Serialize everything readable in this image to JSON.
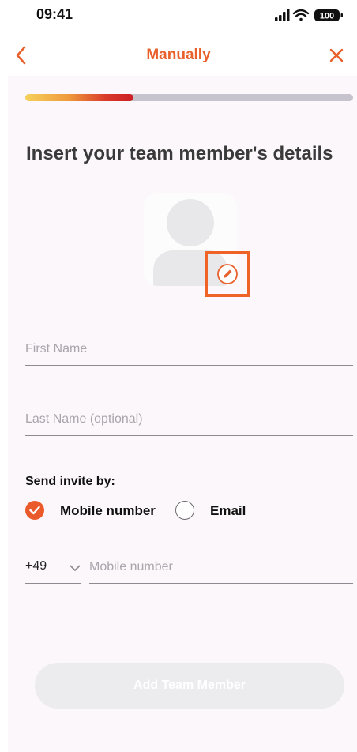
{
  "status_bar": {
    "time": "09:41",
    "battery": "100",
    "icons": [
      "signal-icon",
      "wifi-icon",
      "battery-icon"
    ]
  },
  "nav": {
    "title": "Manually",
    "back_icon": "chevron-left-icon",
    "close_icon": "close-icon"
  },
  "progress": {
    "fraction": 0.33
  },
  "heading": "Insert your team member's details",
  "avatar": {
    "placeholder_icon": "person-placeholder-icon",
    "edit_icon": "pencil-icon"
  },
  "form": {
    "first_name": {
      "value": "",
      "placeholder": "First Name"
    },
    "last_name": {
      "value": "",
      "placeholder": "Last Name (optional)"
    },
    "invite_label": "Send invite by:",
    "invite_options": [
      {
        "label": "Mobile number",
        "selected": true
      },
      {
        "label": "Email",
        "selected": false
      }
    ],
    "country_code": "+49",
    "mobile": {
      "value": "",
      "placeholder": "Mobile number"
    }
  },
  "cta": {
    "label": "Add Team Member",
    "enabled": false
  },
  "colors": {
    "accent": "#e8602c",
    "progress_start": "#f6d15a",
    "progress_end": "#cc1f25",
    "background": "#fcf7fa"
  }
}
